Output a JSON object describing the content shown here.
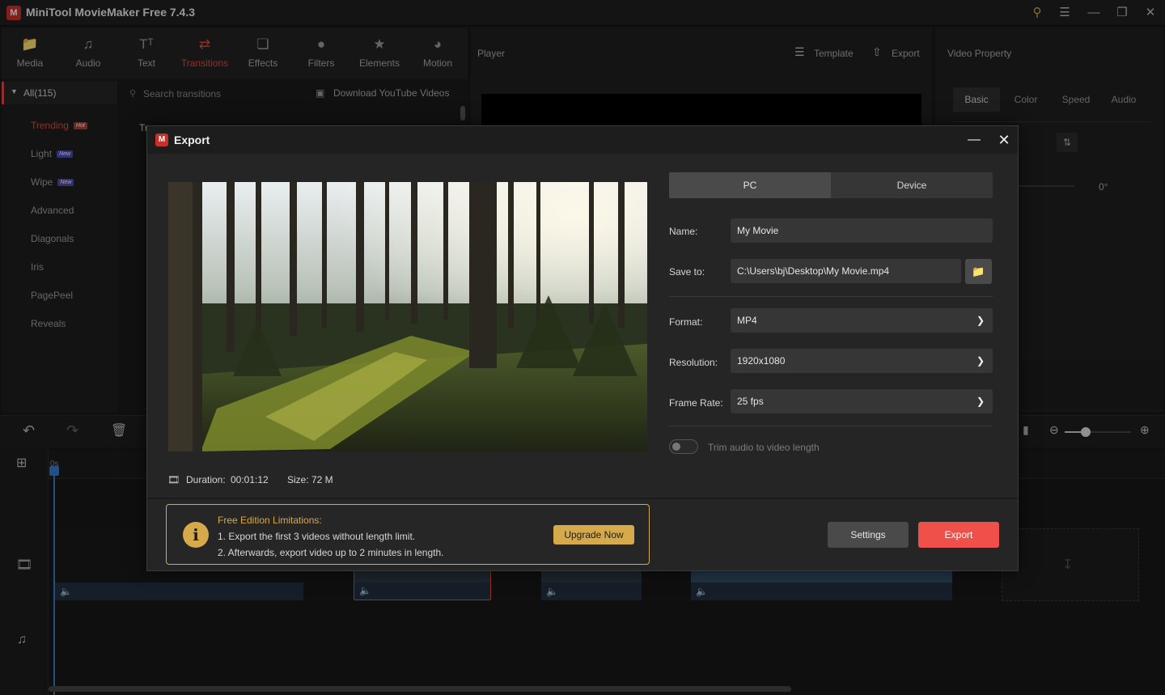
{
  "app": {
    "logo": "M",
    "title": "MiniTool MovieMaker Free 7.4.3"
  },
  "window_controls": {
    "key": "key-icon",
    "menu": "menu-icon",
    "minimize": "minimize-icon",
    "maximize": "maximize-icon",
    "close": "close-icon"
  },
  "toolbar": {
    "items": [
      {
        "label": "Media",
        "icon": "folder-icon"
      },
      {
        "label": "Audio",
        "icon": "music-note-icon"
      },
      {
        "label": "Text",
        "icon": "text-icon"
      },
      {
        "label": "Transitions",
        "icon": "transition-arrows-icon",
        "active": true
      },
      {
        "label": "Effects",
        "icon": "effects-icon"
      },
      {
        "label": "Filters",
        "icon": "filters-icon"
      },
      {
        "label": "Elements",
        "icon": "elements-icon"
      },
      {
        "label": "Motion",
        "icon": "motion-icon"
      }
    ]
  },
  "leftnav": {
    "all_label": "All(115)",
    "items": [
      {
        "label": "Trending",
        "badge": "Hot"
      },
      {
        "label": "Light",
        "badge": "New"
      },
      {
        "label": "Wipe",
        "badge": "New"
      },
      {
        "label": "Advanced"
      },
      {
        "label": "Diagonals"
      },
      {
        "label": "Iris"
      },
      {
        "label": "PagePeel"
      },
      {
        "label": "Reveals"
      }
    ]
  },
  "content": {
    "search_placeholder": "Search transitions",
    "download_label": "Download YouTube Videos",
    "partial_label": "Tr"
  },
  "player": {
    "title": "Player",
    "template_label": "Template",
    "export_label": "Export"
  },
  "property": {
    "title": "Video Property",
    "tabs": [
      "Basic",
      "Color",
      "Speed",
      "Audio"
    ],
    "rotation_value": "0°"
  },
  "timeline": {
    "start_label": "0s"
  },
  "dialog": {
    "logo": "M",
    "title": "Export",
    "tabs": {
      "pc": "PC",
      "device": "Device"
    },
    "name_label": "Name:",
    "name_value": "My Movie",
    "save_label": "Save to:",
    "save_value": "C:\\Users\\bj\\Desktop\\My Movie.mp4",
    "format_label": "Format:",
    "format_value": "MP4",
    "resolution_label": "Resolution:",
    "resolution_value": "1920x1080",
    "framerate_label": "Frame Rate:",
    "framerate_value": "25 fps",
    "trim_label": "Trim audio to video length",
    "trim_on": false,
    "duration_label": "Duration:",
    "duration_value": "00:01:12",
    "size_label": "Size:",
    "size_value": "72 M",
    "limits": {
      "title": "Free Edition Limitations:",
      "line1": "1. Export the first 3 videos without length limit.",
      "line2": "2. Afterwards, export video up to 2 minutes in length.",
      "upgrade_label": "Upgrade Now"
    },
    "settings_label": "Settings",
    "export_label": "Export"
  },
  "colors": {
    "accent": "#e04a3c",
    "export_button": "#f0504a",
    "limit_border": "#d6a94a",
    "upgrade_button": "#d6a94a"
  }
}
